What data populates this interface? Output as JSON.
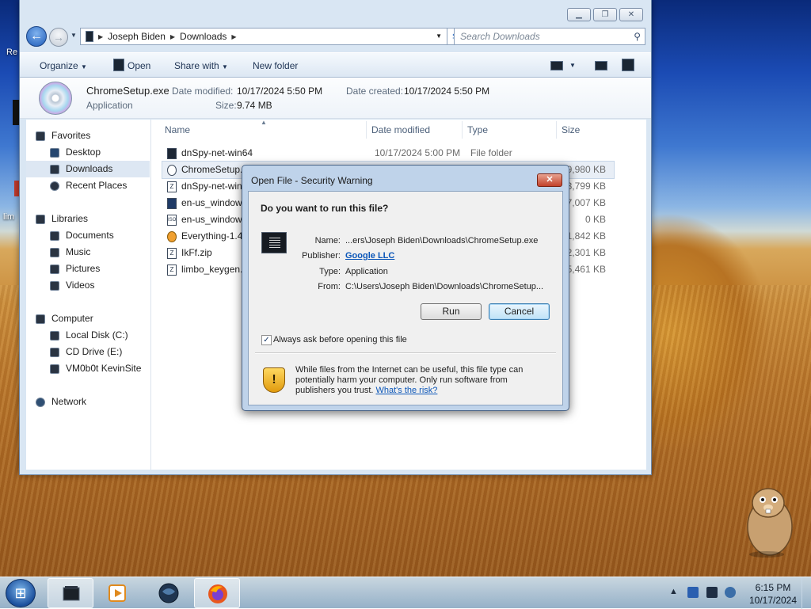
{
  "desktop": {
    "left_labels": [
      "Re",
      "lim"
    ]
  },
  "explorer": {
    "address": {
      "crumbs": [
        "Joseph Biden",
        "Downloads"
      ]
    },
    "search_placeholder": "Search Downloads",
    "toolbar": {
      "organize": "Organize",
      "open": "Open",
      "share_with": "Share with",
      "new_folder": "New folder"
    },
    "details": {
      "file_name": "ChromeSetup.exe",
      "file_type": "Application",
      "modified_label": "Date modified:",
      "modified_value": "10/17/2024 5:50 PM",
      "created_label": "Date created:",
      "created_value": "10/17/2024 5:50 PM",
      "size_label": "Size:",
      "size_value": "9.74 MB"
    },
    "nav": {
      "favorites": "Favorites",
      "desktop": "Desktop",
      "downloads": "Downloads",
      "recent_places": "Recent Places",
      "libraries": "Libraries",
      "documents": "Documents",
      "music": "Music",
      "pictures": "Pictures",
      "videos": "Videos",
      "computer": "Computer",
      "local_disk": "Local Disk (C:)",
      "cd_drive": "CD Drive (E:)",
      "network_share": "VM0b0t KevinSite",
      "network": "Network"
    },
    "columns": {
      "name": "Name",
      "date_modified": "Date modified",
      "type": "Type",
      "size": "Size"
    },
    "files": [
      {
        "name": "dnSpy-net-win64",
        "date": "10/17/2024 5:00 PM",
        "type": "File folder",
        "size": "",
        "icon": "folder-icon"
      },
      {
        "name": "ChromeSetup.",
        "date": "",
        "type": "",
        "size": "9,980 KB",
        "icon": "installer-icon"
      },
      {
        "name": "dnSpy-net-win",
        "date": "",
        "type": "",
        "size": "83,799 KB",
        "icon": "zip-icon"
      },
      {
        "name": "en-us_window",
        "date": "",
        "type": "",
        "size": "7,007 KB",
        "icon": "exe-icon"
      },
      {
        "name": "en-us_window",
        "date": "",
        "type": "",
        "size": "0 KB",
        "icon": "iso-icon"
      },
      {
        "name": "Everything-1.4",
        "date": "",
        "type": "",
        "size": "1,842 KB",
        "icon": "search-app-icon"
      },
      {
        "name": "IkFf.zip",
        "date": "",
        "type": "",
        "size": "2,301 KB",
        "icon": "zip-icon"
      },
      {
        "name": "limbo_keygen.",
        "date": "",
        "type": "",
        "size": "15,461 KB",
        "icon": "zip-icon"
      }
    ]
  },
  "dialog": {
    "title": "Open File - Security Warning",
    "question": "Do you want to run this file?",
    "name_label": "Name:",
    "name_value": "...ers\\Joseph Biden\\Downloads\\ChromeSetup.exe",
    "publisher_label": "Publisher:",
    "publisher_value": "Google LLC",
    "type_label": "Type:",
    "type_value": "Application",
    "from_label": "From:",
    "from_value": "C:\\Users\\Joseph Biden\\Downloads\\ChromeSetup...",
    "run": "Run",
    "cancel": "Cancel",
    "always_ask": "Always ask before opening this file",
    "always_ask_checked": true,
    "warning_text": "While files from the Internet can be useful, this file type can potentially harm your computer. Only run software from publishers you trust.",
    "warning_link": "What's the risk?"
  },
  "taskbar": {
    "apps": [
      "explorer",
      "media-player",
      "app-globe",
      "firefox"
    ],
    "clock_time": "6:15 PM",
    "clock_date": "10/17/2024"
  },
  "colors": {
    "accent": "#0b56b8",
    "dialog_frame": "#bfd3ea",
    "window_frame": "#d9e6f3"
  }
}
